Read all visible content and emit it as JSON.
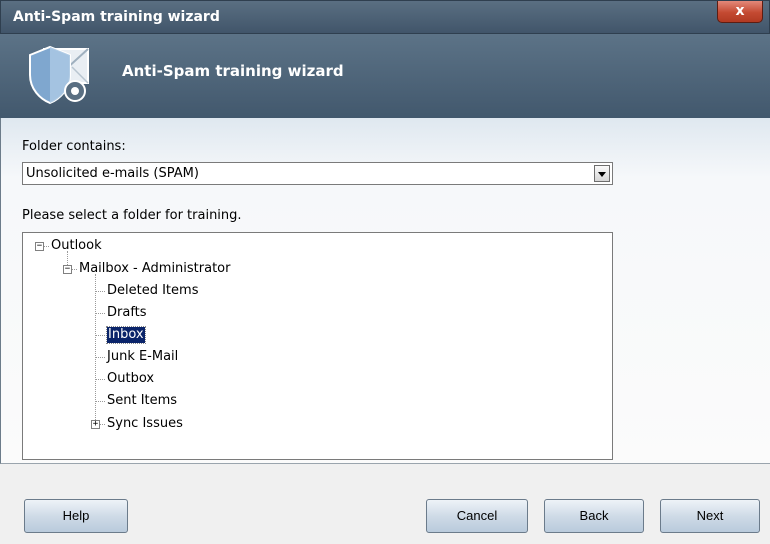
{
  "window": {
    "title": "Anti-Spam training wizard",
    "close_symbol": "x"
  },
  "header": {
    "title": "Anti-Spam training wizard",
    "icon": "shield-envelope-gear-icon"
  },
  "form": {
    "folder_contains_label": "Folder contains:",
    "folder_contains_value": "Unsolicited e-mails (SPAM)",
    "select_folder_label": "Please select a folder for training."
  },
  "tree": {
    "root": {
      "label": "Outlook",
      "expander": "−"
    },
    "mailbox": {
      "label": "Mailbox - Administrator",
      "expander": "−"
    },
    "folders": [
      "Deleted Items",
      "Drafts",
      "Inbox",
      "Junk E-Mail",
      "Outbox",
      "Sent Items"
    ],
    "sync_issues": {
      "label": "Sync Issues",
      "expander": "+"
    },
    "selected": "Inbox"
  },
  "buttons": {
    "help": "Help",
    "cancel": "Cancel",
    "back": "Back",
    "next": "Next"
  }
}
